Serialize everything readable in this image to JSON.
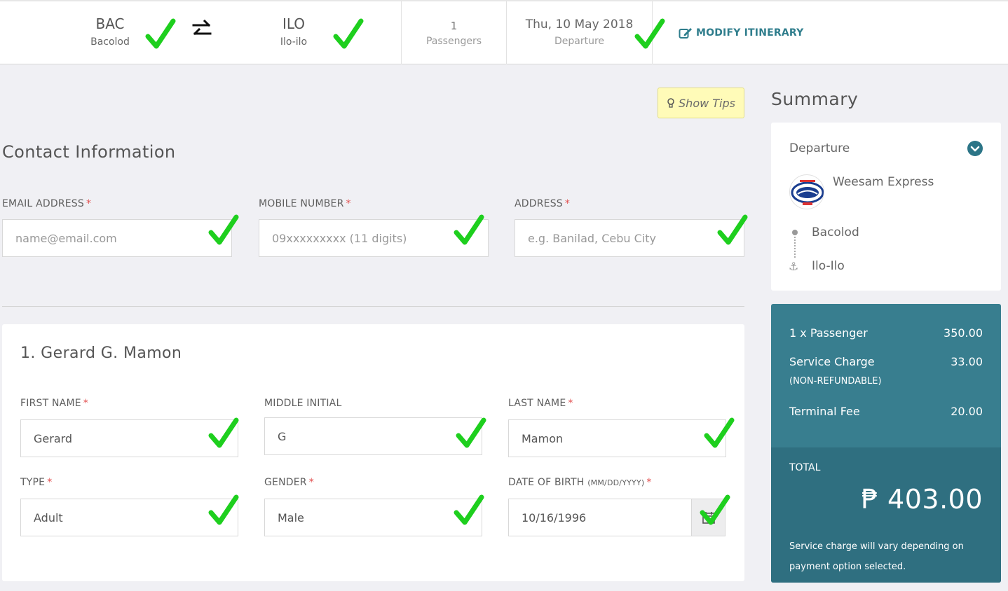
{
  "itinerary": {
    "origin_code": "BAC",
    "origin_name": "Bacolod",
    "destination_code": "ILO",
    "destination_name": "Ilo-ilo",
    "passenger_count": "1",
    "passenger_label": "Passengers",
    "date": "Thu, 10 May 2018",
    "date_label": "Departure",
    "modify_label": "MODIFY ITINERARY"
  },
  "tips": {
    "label": "Show Tips"
  },
  "contact": {
    "title": "Contact Information",
    "email_label": "EMAIL ADDRESS",
    "email_placeholder": "name@email.com",
    "mobile_label": "MOBILE NUMBER",
    "mobile_placeholder": "09xxxxxxxxx (11 digits)",
    "address_label": "ADDRESS",
    "address_placeholder": "e.g. Banilad, Cebu City",
    "required_mark": "*"
  },
  "passenger": {
    "title": "1. Gerard G. Mamon",
    "first_name_label": "FIRST NAME",
    "first_name": "Gerard",
    "middle_initial_label": "MIDDLE INITIAL",
    "middle_initial": "G",
    "last_name_label": "LAST NAME",
    "last_name": "Mamon",
    "type_label": "TYPE",
    "type": "Adult",
    "gender_label": "GENDER",
    "gender": "Male",
    "dob_label": "DATE OF BIRTH",
    "dob_format": "(MM/DD/YYYY)",
    "dob": "10/16/1996"
  },
  "summary": {
    "title": "Summary",
    "departure_label": "Departure",
    "carrier": "Weesam Express",
    "route_from": "Bacolod",
    "route_to": "Ilo-Ilo",
    "lines": [
      {
        "label": "1 x Passenger",
        "amount": "350.00"
      },
      {
        "label": "Service Charge",
        "amount": "33.00"
      },
      {
        "label": "Terminal Fee",
        "amount": "20.00"
      }
    ],
    "service_note": "(NON-REFUNDABLE)",
    "total_label": "TOTAL",
    "total_amount": "₱ 403.00",
    "footer_note": "Service charge will vary depending on payment option selected."
  },
  "colors": {
    "accent": "#387e8f",
    "accent_dark": "#2f6f80",
    "check": "#1ecf1e",
    "required": "#e25050",
    "tips_bg": "#fffbb8"
  }
}
